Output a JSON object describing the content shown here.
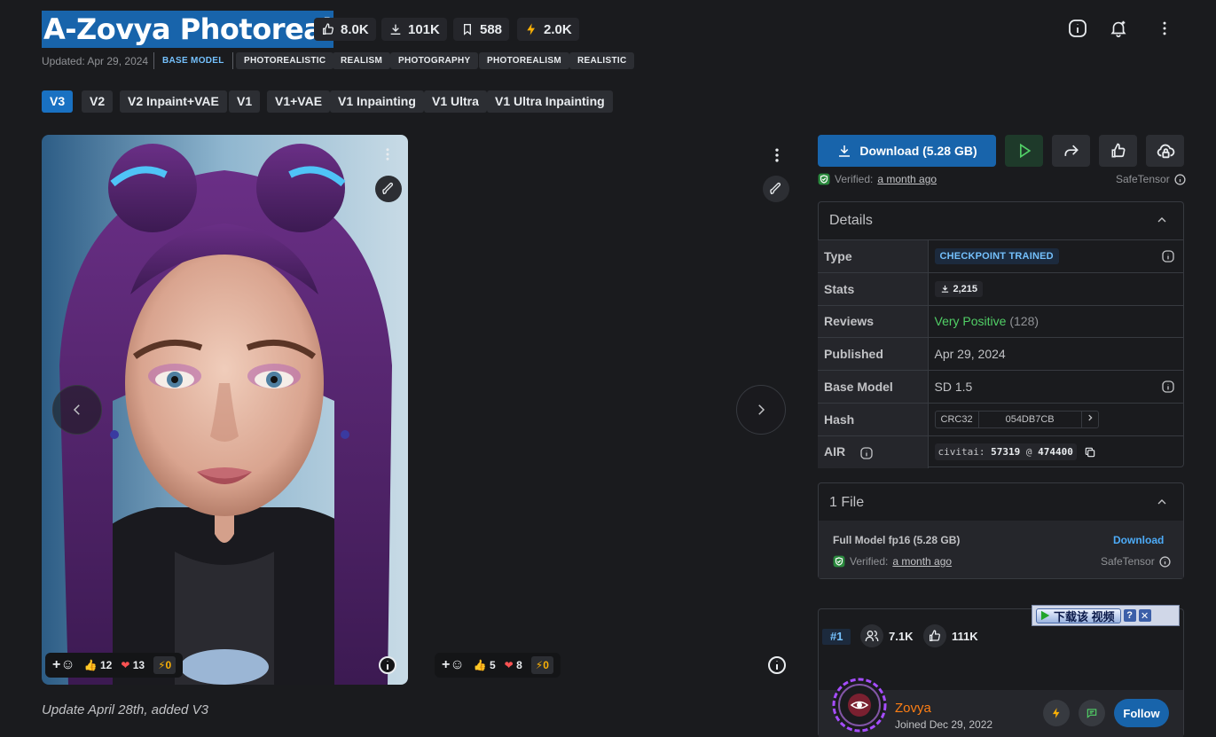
{
  "header": {
    "title": "A-Zovya Photoreal",
    "stats": {
      "likes": "8.0K",
      "downloads": "101K",
      "bookmarks": "588",
      "buzz": "2.0K"
    },
    "updated": "Updated: Apr 29, 2024",
    "base_model_tag": "BASE MODEL",
    "tags": [
      "PHOTOREALISTIC",
      "REALISM",
      "PHOTOGRAPHY",
      "PHOTOREALISM",
      "REALISTIC"
    ]
  },
  "versions": [
    "V3",
    "V2",
    "V2 Inpaint+VAE",
    "V1",
    "V1+VAE",
    "V1 Inpainting",
    "V1 Ultra",
    "V1 Ultra Inpainting"
  ],
  "gallery": {
    "card1": {
      "thumbs": "12",
      "hearts": "13",
      "buzz": "0"
    },
    "card2": {
      "thumbs": "5",
      "hearts": "8",
      "buzz": "0"
    },
    "caption": "Update April 28th, added V3"
  },
  "sidebar": {
    "download_label": "Download (5.28 GB)",
    "verified_label": "Verified:",
    "verified_when": "a month ago",
    "safetensor": "SafeTensor",
    "details": {
      "title": "Details",
      "type_label": "Type",
      "type_value": "CHECKPOINT TRAINED",
      "stats_label": "Stats",
      "stats_value": "2,215",
      "reviews_label": "Reviews",
      "reviews_value": "Very Positive",
      "reviews_count": "(128)",
      "published_label": "Published",
      "published_value": "Apr 29, 2024",
      "base_label": "Base Model",
      "base_value": "SD 1.5",
      "hash_label": "Hash",
      "hash_type": "CRC32",
      "hash_value": "054DB7CB",
      "air_label": "AIR",
      "air_prefix": "civitai:",
      "air_model": "57319",
      "air_at": "@",
      "air_version": "474400"
    },
    "files": {
      "title": "1 File",
      "file_name": "Full Model fp16 (5.28 GB)",
      "download_link": "Download",
      "verified_label": "Verified:",
      "verified_when": "a month ago",
      "safetensor": "SafeTensor"
    },
    "ad_text": "下载该 视频",
    "creator": {
      "rank": "#1",
      "followers": "7.1K",
      "likes": "111K",
      "name": "Zovya",
      "joined": "Joined Dec 29, 2022",
      "follow_label": "Follow"
    }
  },
  "colors": {
    "accent": "#1864ab",
    "positive": "#51cf66",
    "creator": "#fd7e14",
    "buzz": "#fab005"
  }
}
